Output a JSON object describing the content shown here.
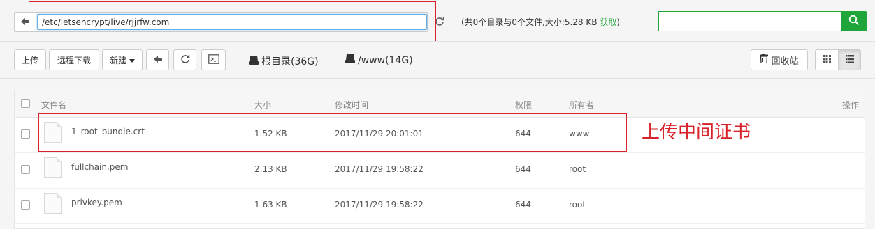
{
  "toolbar": {
    "path_value": "/etc/letsencrypt/live/rjjrfw.com",
    "summary": "(共0个目录与0个文件,大小:",
    "size_value": "5.28 KB",
    "fetch_label": "获取",
    "close_paren": ")",
    "search_placeholder": ""
  },
  "actions": {
    "upload": "上传",
    "remote_download": "远程下载",
    "new_label": "新建",
    "disk_root": "根目录(36G)",
    "disk_www": "/www(14G)",
    "recycle_bin": "回收站"
  },
  "table": {
    "headers": {
      "name": "文件名",
      "size": "大小",
      "modified": "修改时间",
      "perm": "权限",
      "owner": "所有者",
      "ops": "操作"
    },
    "rows": [
      {
        "name": "1_root_bundle.crt",
        "size": "1.52 KB",
        "modified": "2017/11/29 20:01:01",
        "perm": "644",
        "owner": "www"
      },
      {
        "name": "fullchain.pem",
        "size": "2.13 KB",
        "modified": "2017/11/29 19:58:22",
        "perm": "644",
        "owner": "root"
      },
      {
        "name": "privkey.pem",
        "size": "1.63 KB",
        "modified": "2017/11/29 19:58:22",
        "perm": "644",
        "owner": "root"
      }
    ]
  },
  "annotation": "上传中间证书",
  "colors": {
    "accent_green": "#20a53a",
    "annotation_red": "#d9222a"
  },
  "icons": [
    "back-arrow-icon",
    "refresh-icon",
    "search-icon",
    "caret-down-icon",
    "terminal-icon",
    "hdd-icon",
    "trash-icon",
    "grid-view-icon",
    "list-view-icon",
    "file-icon"
  ]
}
